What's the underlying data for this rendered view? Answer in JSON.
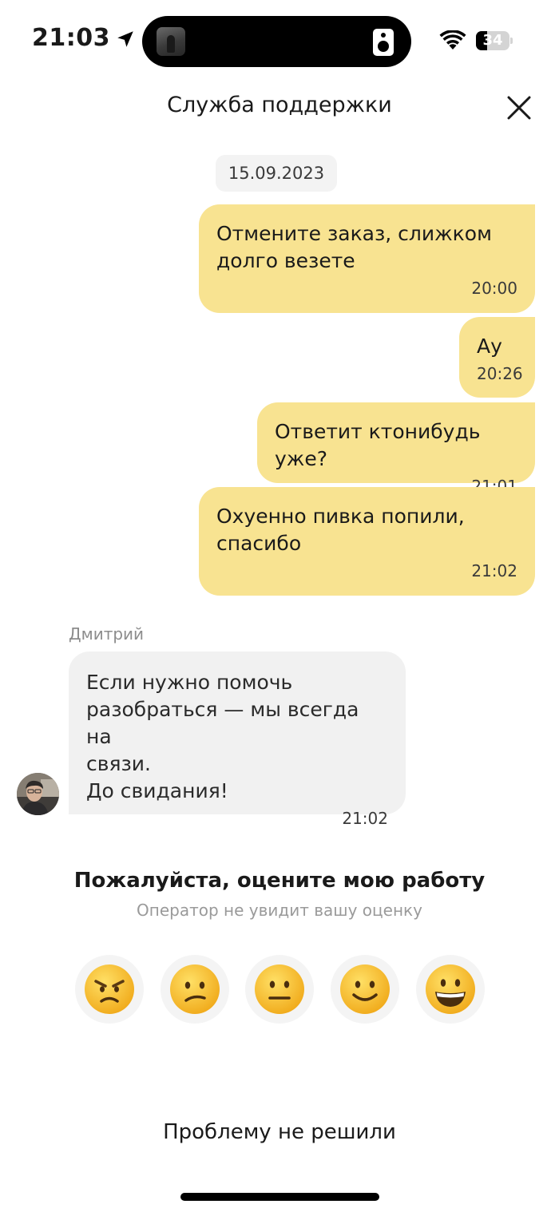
{
  "status_bar": {
    "time": "21:03",
    "battery_level": "34",
    "battery_fraction": 0.34
  },
  "header": {
    "title": "Служба поддержки",
    "close_icon": "close-icon"
  },
  "chat": {
    "date": "15.09.2023",
    "outgoing_messages": [
      {
        "text": "Отмените заказ, слижком\nдолго везете",
        "time": "20:00"
      },
      {
        "text": "Ау",
        "time": "20:26"
      },
      {
        "text": "Ответит ктонибудь уже?",
        "time": "21:01"
      },
      {
        "text": "Охуенно пивка попили,\nспасибо",
        "time": "21:02"
      }
    ],
    "incoming": {
      "sender": "Дмитрий",
      "text": "Если нужно помочь\nразобраться — мы всегда на\nсвязи.\nДо свидания!",
      "time": "21:02"
    }
  },
  "rating": {
    "title": "Пожалуйста, оцените мою работу",
    "subtitle": "Оператор не увидит вашу оценку",
    "options": [
      "angry-face-icon",
      "confused-face-icon",
      "neutral-face-icon",
      "slightly-smiling-face-icon",
      "grinning-face-icon"
    ]
  },
  "actions": {
    "unresolved_label": "Проблему не решили"
  },
  "colors": {
    "outgoing_bubble": "#f8e391",
    "incoming_bubble": "#f1f1f1",
    "emoji_face": "#fbc82b"
  }
}
